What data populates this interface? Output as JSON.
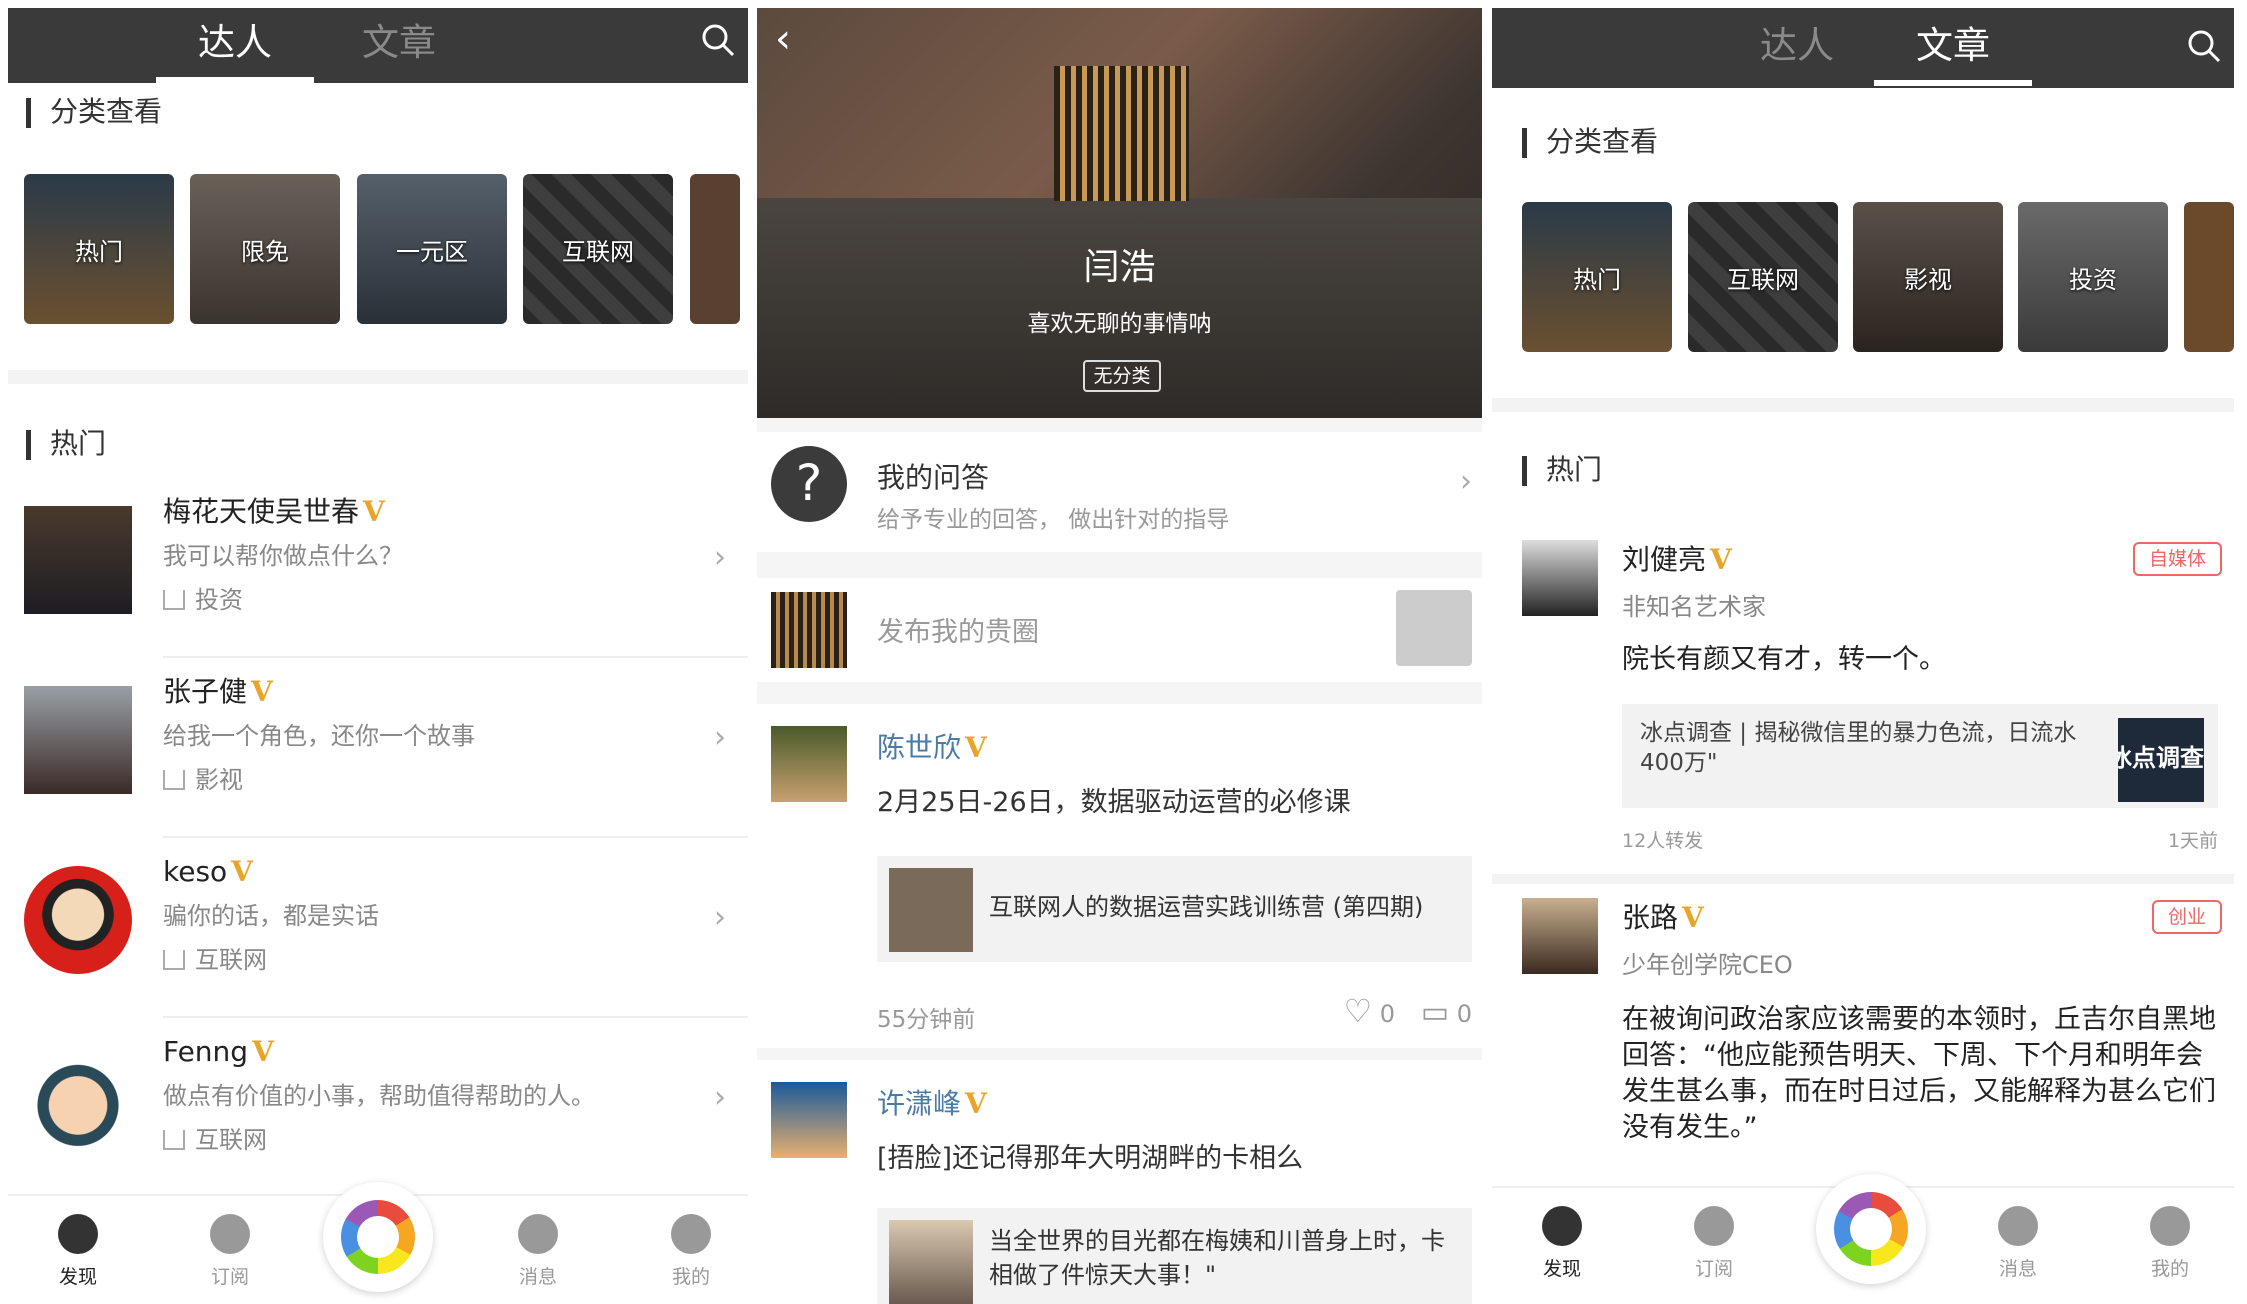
{
  "left": {
    "tabs": [
      "达人",
      "文章"
    ],
    "active_tab": 0,
    "category_heading": "分类查看",
    "categories": [
      "热门",
      "限免",
      "一元区",
      "互联网"
    ],
    "hot_heading": "热门",
    "experts": [
      {
        "name": "梅花天使吴世春",
        "verified": "V",
        "tagline": "我可以帮你做点什么？",
        "category": "投资"
      },
      {
        "name": "张子健",
        "verified": "V",
        "tagline": "给我一个角色，还你一个故事",
        "category": "影视"
      },
      {
        "name": "keso",
        "verified": "V",
        "tagline": "骗你的话，都是实话",
        "category": "互联网"
      },
      {
        "name": "Fenng",
        "verified": "V",
        "tagline": "做点有价值的小事，帮助值得帮助的人。",
        "category": "互联网"
      }
    ]
  },
  "middle": {
    "profile_name": "闫浩",
    "profile_bio": "喜欢无聊的事情呐",
    "profile_badge": "无分类",
    "qa_title": "我的问答",
    "qa_sub": "给予专业的回答， 做出针对的指导",
    "publish_placeholder": "发布我的贵圈",
    "posts": [
      {
        "name": "陈世欣",
        "verified": "V",
        "text": "2月25日-26日，数据驱动运营的必修课",
        "link": "互联网人的数据运营实践训练营 (第四期)",
        "time": "55分钟前",
        "likes": "0",
        "comments": "0"
      },
      {
        "name": "许潇峰",
        "verified": "V",
        "text": "[捂脸]还记得那年大明湖畔的卡相么",
        "link": "当全世界的目光都在梅姨和川普身上时，卡相做了件惊天大事！\""
      }
    ]
  },
  "right": {
    "tabs": [
      "达人",
      "文章"
    ],
    "active_tab": 1,
    "category_heading": "分类查看",
    "categories": [
      "热门",
      "互联网",
      "影视",
      "投资"
    ],
    "hot_heading": "热门",
    "articles": [
      {
        "name": "刘健亮",
        "verified": "V",
        "tag": "自媒体",
        "subtitle": "非知名艺术家",
        "body": "院长有颜又有才，转一个。",
        "link": "冰点调查 | 揭秘微信里的暴力色流，日流水400万\"",
        "link_thumb_text": "冰点调查",
        "shares": "12人转发",
        "time": "1天前"
      },
      {
        "name": "张路",
        "verified": "V",
        "tag": "创业",
        "subtitle": "少年创学院CEO",
        "body": "在被询问政治家应该需要的本领时，丘吉尔自黑地回答：“他应能预告明天、下周、下个月和明年会发生甚么事，而在时日过后，又能解释为甚么它们没有发生。”"
      }
    ]
  },
  "nav": [
    "发现",
    "订阅",
    "消息",
    "我的"
  ]
}
